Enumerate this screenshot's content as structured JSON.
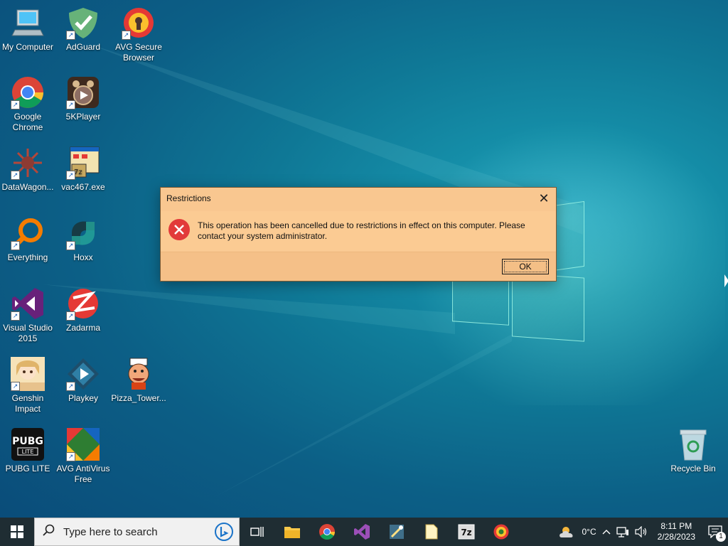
{
  "desktop": {
    "icons": [
      {
        "label": "My Computer",
        "icon": "computer-icon"
      },
      {
        "label": "AdGuard",
        "icon": "adguard-icon"
      },
      {
        "label": "AVG Secure Browser",
        "icon": "avg-secure-browser-icon"
      },
      {
        "label": "Google Chrome",
        "icon": "chrome-icon"
      },
      {
        "label": "5KPlayer",
        "icon": "5kplayer-icon"
      },
      {
        "label": "DataWagon...",
        "icon": "datawagon-icon"
      },
      {
        "label": "vac467.exe",
        "icon": "vac467-icon"
      },
      {
        "label": "Everything",
        "icon": "everything-icon"
      },
      {
        "label": "Hoxx",
        "icon": "hoxx-icon"
      },
      {
        "label": "Visual Studio 2015",
        "icon": "visual-studio-icon"
      },
      {
        "label": "Zadarma",
        "icon": "zadarma-icon"
      },
      {
        "label": "Genshin Impact",
        "icon": "genshin-icon"
      },
      {
        "label": "Playkey",
        "icon": "playkey-icon"
      },
      {
        "label": "Pizza_Tower...",
        "icon": "pizza-tower-icon"
      },
      {
        "label": "PUBG LITE",
        "icon": "pubg-lite-icon"
      },
      {
        "label": "AVG AntiVirus Free",
        "icon": "avg-antivirus-icon"
      },
      {
        "label": "Recycle Bin",
        "icon": "recycle-bin-icon"
      }
    ]
  },
  "dialog": {
    "title": "Restrictions",
    "close_glyph": "✕",
    "message": "This operation has been cancelled due to restrictions in effect on this computer. Please contact your system administrator.",
    "ok_label": "OK",
    "icon": "error-icon"
  },
  "taskbar": {
    "search_placeholder": "Type here to search",
    "pinned": [
      "task-view-icon",
      "file-explorer-icon",
      "chrome-icon",
      "visual-studio-icon",
      "tool-icon",
      "notepad-icon",
      "7zip-icon",
      "avg-browser-icon"
    ],
    "seven_zip_label": "7z",
    "weather_temp": "0°C",
    "time": "8:11 PM",
    "date": "2/28/2023",
    "notification_count": "1"
  },
  "colors": {
    "dialog_bg": "#f9c790",
    "taskbar_bg": "#1f2d33",
    "error_red": "#e23a3a"
  }
}
